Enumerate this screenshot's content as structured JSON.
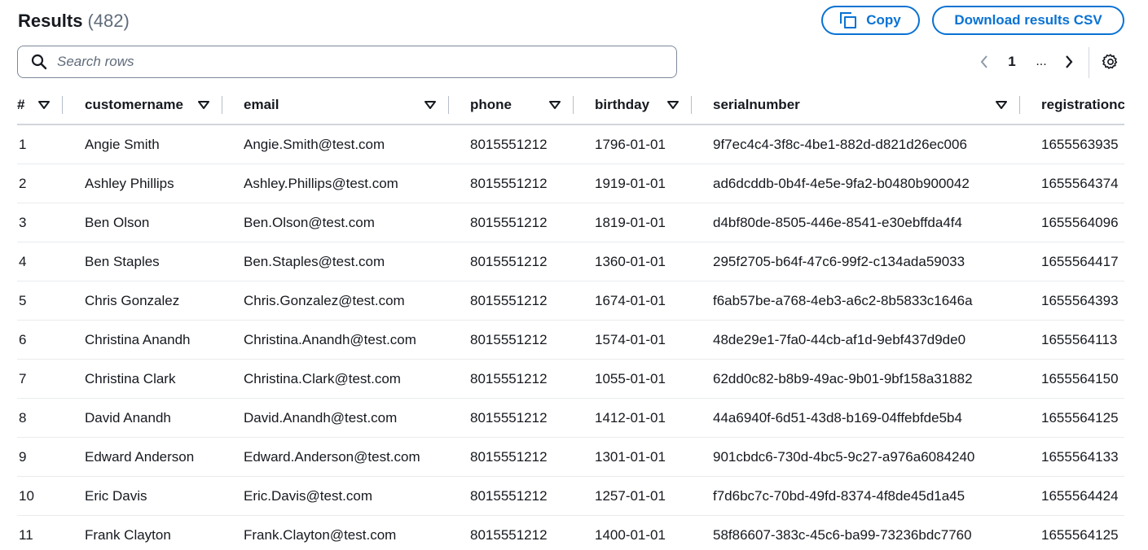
{
  "header": {
    "title": "Results",
    "count": "(482)"
  },
  "actions": {
    "copy_label": "Copy",
    "download_label": "Download results CSV"
  },
  "search": {
    "placeholder": "Search rows",
    "value": ""
  },
  "pagination": {
    "current_page": "1",
    "ellipsis": "..."
  },
  "icons": {
    "copy": "copy-icon",
    "search": "search-icon",
    "prev": "chevron-left-icon",
    "next": "chevron-right-icon",
    "settings": "gear-icon",
    "sort": "sort-caret-down-icon"
  },
  "colors": {
    "accent": "#0972d3",
    "text": "#16191f",
    "muted": "#5f6b7a",
    "border": "#d1d5db"
  },
  "table": {
    "columns": [
      "#",
      "customername",
      "email",
      "phone",
      "birthday",
      "serialnumber",
      "registrationc"
    ],
    "rows": [
      [
        "1",
        "Angie Smith",
        "Angie.Smith@test.com",
        "8015551212",
        "1796-01-01",
        "9f7ec4c4-3f8c-4be1-882d-d821d26ec006",
        "1655563935"
      ],
      [
        "2",
        "Ashley Phillips",
        "Ashley.Phillips@test.com",
        "8015551212",
        "1919-01-01",
        "ad6dcddb-0b4f-4e5e-9fa2-b0480b900042",
        "1655564374"
      ],
      [
        "3",
        "Ben Olson",
        "Ben.Olson@test.com",
        "8015551212",
        "1819-01-01",
        "d4bf80de-8505-446e-8541-e30ebffda4f4",
        "1655564096"
      ],
      [
        "4",
        "Ben Staples",
        "Ben.Staples@test.com",
        "8015551212",
        "1360-01-01",
        "295f2705-b64f-47c6-99f2-c134ada59033",
        "1655564417"
      ],
      [
        "5",
        "Chris Gonzalez",
        "Chris.Gonzalez@test.com",
        "8015551212",
        "1674-01-01",
        "f6ab57be-a768-4eb3-a6c2-8b5833c1646a",
        "1655564393"
      ],
      [
        "6",
        "Christina Anandh",
        "Christina.Anandh@test.com",
        "8015551212",
        "1574-01-01",
        "48de29e1-7fa0-44cb-af1d-9ebf437d9de0",
        "1655564113"
      ],
      [
        "7",
        "Christina Clark",
        "Christina.Clark@test.com",
        "8015551212",
        "1055-01-01",
        "62dd0c82-b8b9-49ac-9b01-9bf158a31882",
        "1655564150"
      ],
      [
        "8",
        "David Anandh",
        "David.Anandh@test.com",
        "8015551212",
        "1412-01-01",
        "44a6940f-6d51-43d8-b169-04ffebfde5b4",
        "1655564125"
      ],
      [
        "9",
        "Edward Anderson",
        "Edward.Anderson@test.com",
        "8015551212",
        "1301-01-01",
        "901cbdc6-730d-4bc5-9c27-a976a6084240",
        "1655564133"
      ],
      [
        "10",
        "Eric Davis",
        "Eric.Davis@test.com",
        "8015551212",
        "1257-01-01",
        "f7d6bc7c-70bd-49fd-8374-4f8de45d1a45",
        "1655564424"
      ],
      [
        "11",
        "Frank Clayton",
        "Frank.Clayton@test.com",
        "8015551212",
        "1400-01-01",
        "58f86607-383c-45c6-ba99-73236bdc7760",
        "1655564125"
      ]
    ]
  }
}
